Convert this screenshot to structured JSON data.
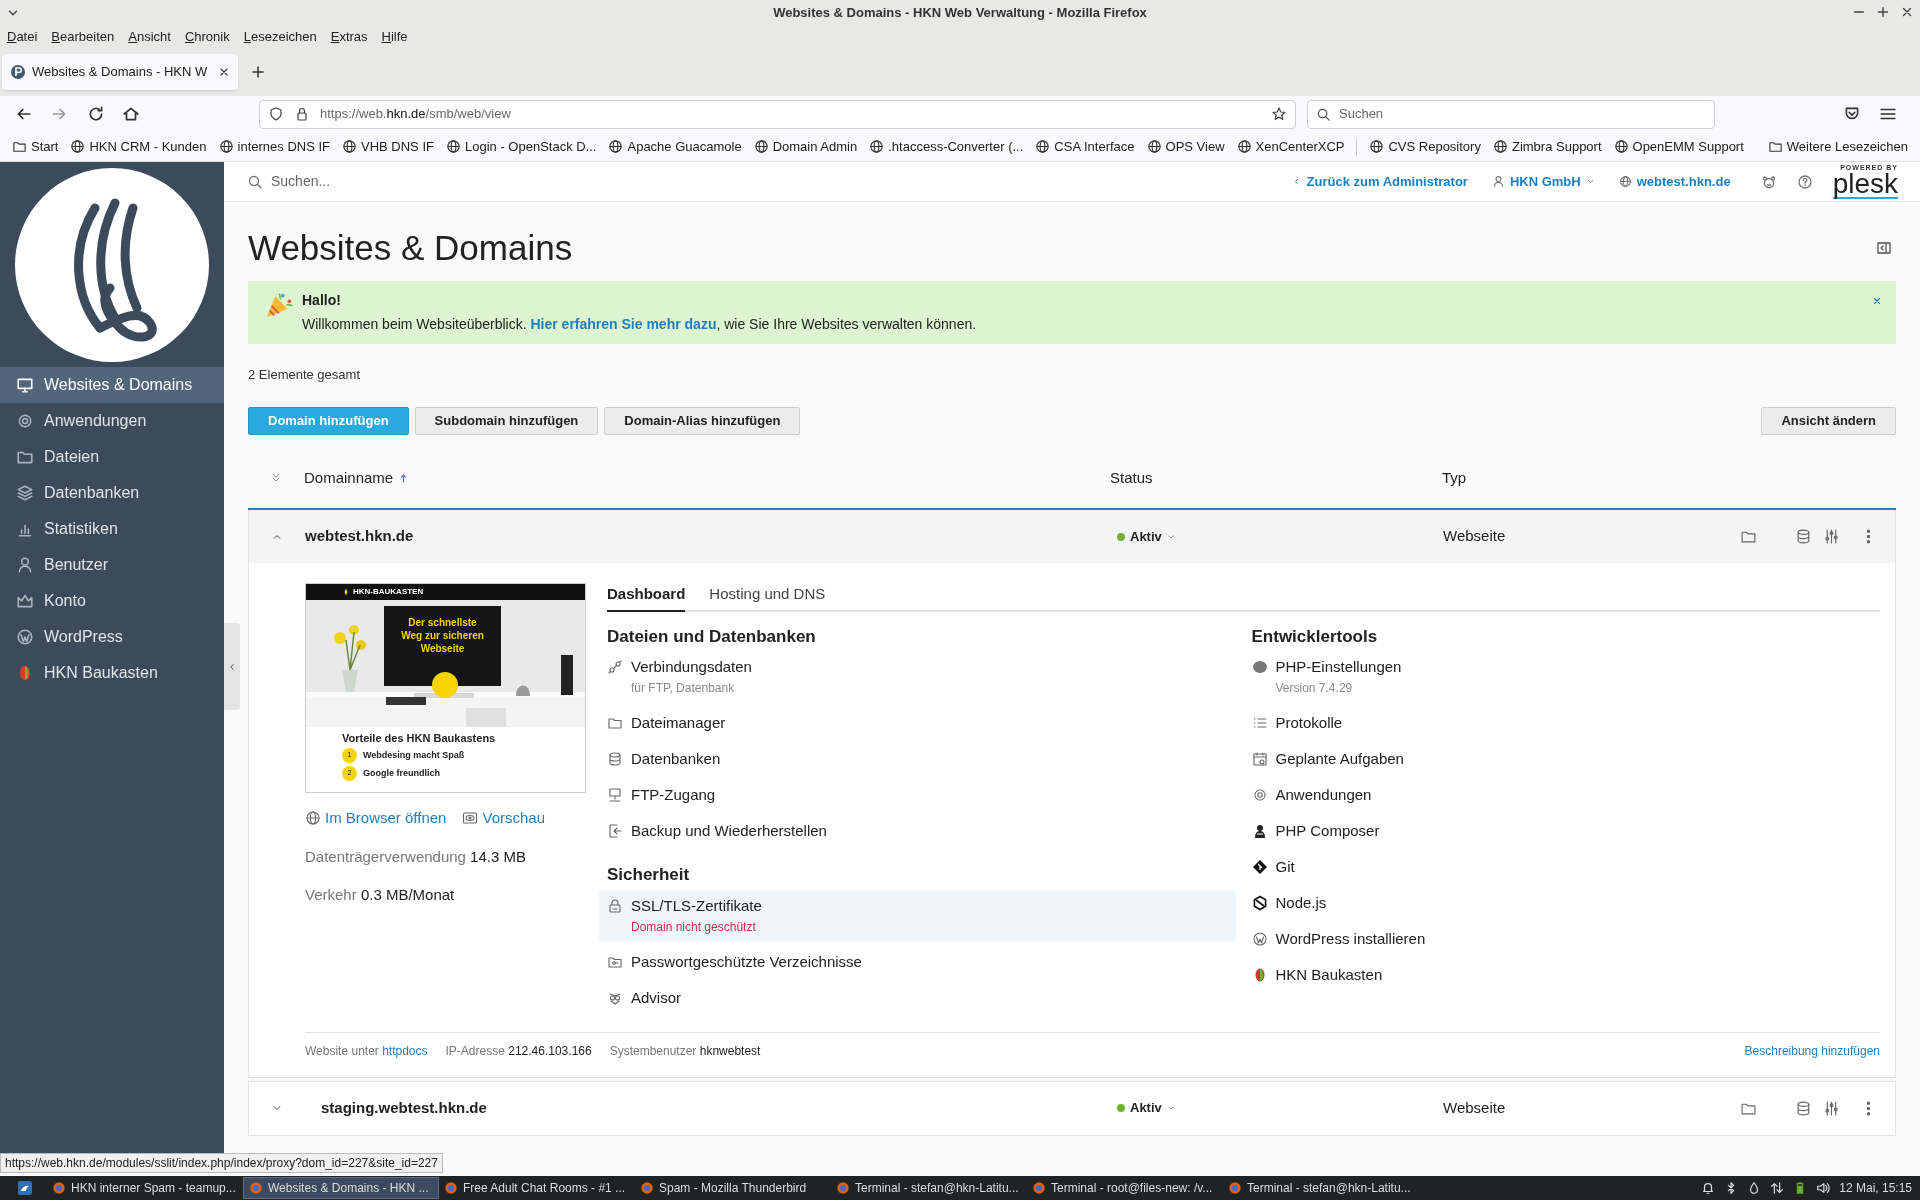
{
  "window": {
    "title": "Websites & Domains - HKN Web Verwaltung - Mozilla Firefox"
  },
  "menu_bar": [
    "Datei",
    "Bearbeiten",
    "Ansicht",
    "Chronik",
    "Lesezeichen",
    "Extras",
    "Hilfe"
  ],
  "tabs": [
    {
      "label": "Websites & Domains - HKN W",
      "selected": true
    }
  ],
  "address_bar": {
    "url": "https://web.**hkn.de**/smb/web/view"
  },
  "browser_search": {
    "placeholder": "Suchen"
  },
  "bookmarks": [
    {
      "label": "Start",
      "kind": "folder"
    },
    {
      "label": "HKN CRM - Kunden",
      "kind": "site"
    },
    {
      "label": "internes DNS IF",
      "kind": "site"
    },
    {
      "label": "VHB DNS IF",
      "kind": "site"
    },
    {
      "label": "Login - OpenStack D...",
      "kind": "site"
    },
    {
      "label": "Apache Guacamole",
      "kind": "site"
    },
    {
      "label": "Domain Admin",
      "kind": "site"
    },
    {
      "label": ".htaccess-Converter (...",
      "kind": "site"
    },
    {
      "label": "CSA Interface",
      "kind": "site"
    },
    {
      "label": "OPS View",
      "kind": "site"
    },
    {
      "label": "XenCenterXCP",
      "kind": "site"
    },
    {
      "label": "CVS Repository",
      "kind": "site"
    },
    {
      "label": "Zimbra Support",
      "kind": "site"
    },
    {
      "label": "OpenEMM Support",
      "kind": "site"
    }
  ],
  "other_bookmarks": "Weitere Lesezeichen",
  "sidebar": {
    "items": [
      {
        "label": "Websites & Domains",
        "selected": true
      },
      {
        "label": "Anwendungen",
        "selected": false
      },
      {
        "label": "Dateien",
        "selected": false
      },
      {
        "label": "Datenbanken",
        "selected": false
      },
      {
        "label": "Statistiken",
        "selected": false
      },
      {
        "label": "Benutzer",
        "selected": false
      },
      {
        "label": "Konto",
        "selected": false
      },
      {
        "label": "WordPress",
        "selected": false
      },
      {
        "label": "HKN Baukasten",
        "selected": false
      }
    ]
  },
  "header": {
    "search_placeholder": "Suchen...",
    "back_link": "Zurück zum Administrator",
    "account": "HKN GmbH",
    "domain": "webtest.hkn.de",
    "powered_by": "POWERED BY",
    "brand": "plesk"
  },
  "page_title": "Websites & Domains",
  "banner": {
    "title": "Hallo!",
    "message": "Willkommen beim Websiteüberblick. ",
    "link": "Hier erfahren Sie mehr dazu",
    "message_end": ", wie Sie Ihre Websites verwalten können."
  },
  "item_count": "2 Elemente gesamt",
  "toolbar": {
    "buttons": [
      {
        "label": "Domain hinzufügen",
        "primary": true
      },
      {
        "label": "Subdomain hinzufügen",
        "primary": false
      },
      {
        "label": "Domain-Alias hinzufügen",
        "primary": false
      }
    ],
    "view_button": "Ansicht ändern"
  },
  "table": {
    "columns": [
      "Domainname",
      "Status",
      "Typ"
    ],
    "rows": [
      {
        "domain": "webtest.hkn.de",
        "status": {
          "label": "Aktiv",
          "color": "#6bb42c"
        },
        "type": "Webseite",
        "expanded": true
      },
      {
        "domain": "staging.webtest.hkn.de",
        "status": {
          "label": "Aktiv",
          "color": "#6bb42c"
        },
        "type": "Webseite",
        "expanded": false
      }
    ]
  },
  "detail": {
    "preview": {
      "logo": "HKN-BAUKASTEN",
      "headline": "Der schnellste Weg zur sicheren Webseite",
      "section": "Vorteile des HKN Baukastens",
      "points": [
        {
          "number": "1",
          "title": "Webdesing macht Spaß"
        },
        {
          "number": "2",
          "title": "Google freundlich"
        }
      ]
    },
    "links": [
      "Im Browser öffnen",
      "Vorschau"
    ],
    "stats": [
      {
        "label": "Datenträgerverwendung",
        "value": "14.3 MB"
      },
      {
        "label": "Verkehr",
        "value": "0.3 MB/Monat"
      }
    ],
    "tabs": [
      {
        "label": "Dashboard",
        "selected": true
      },
      {
        "label": "Hosting und DNS",
        "selected": false
      }
    ],
    "columns": [
      [
        {
          "title": "Dateien und Datenbanken",
          "items": [
            {
              "label": "Verbindungsdaten",
              "sub": "für FTP, Datenbank",
              "highlighted": false,
              "warning": false
            },
            {
              "label": "Dateimanager",
              "highlighted": false
            },
            {
              "label": "Datenbanken",
              "highlighted": false
            },
            {
              "label": "FTP-Zugang",
              "highlighted": false
            },
            {
              "label": "Backup und Wiederherstellen",
              "highlighted": false
            }
          ]
        },
        {
          "title": "Sicherheit",
          "items": [
            {
              "label": "SSL/TLS-Zertifikate",
              "sub": "Domain nicht geschützt",
              "highlighted": true,
              "warning": true
            },
            {
              "label": "Passwortgeschützte Verzeichnisse",
              "highlighted": false
            },
            {
              "label": "Advisor",
              "highlighted": false
            }
          ]
        }
      ],
      [
        {
          "title": "Entwicklertools",
          "items": [
            {
              "label": "PHP-Einstellungen",
              "sub": "Version 7.4.29",
              "highlighted": false,
              "warning": false
            },
            {
              "label": "Protokolle",
              "highlighted": false
            },
            {
              "label": "Geplante Aufgaben",
              "highlighted": false
            },
            {
              "label": "Anwendungen",
              "highlighted": false
            },
            {
              "label": "PHP Composer",
              "highlighted": false
            },
            {
              "label": "Git",
              "highlighted": false
            },
            {
              "label": "Node.js",
              "highlighted": false
            },
            {
              "label": "WordPress installieren",
              "highlighted": false
            },
            {
              "label": "HKN Baukasten",
              "highlighted": false
            }
          ]
        }
      ]
    ],
    "footer": [
      {
        "label": "Website unter",
        "value": "httpdocs",
        "link": true
      },
      {
        "label": "IP-Adresse",
        "value": "212.46.103.166",
        "link": false
      },
      {
        "label": "Systembenutzer",
        "value": "hknwebtest",
        "link": false
      }
    ],
    "footer_link": "Beschreibung hinzufügen"
  },
  "status_url": "https://web.hkn.de/modules/sslit/index.php/index/proxy?dom_id=227&site_id=227",
  "taskbar": {
    "tasks": [
      {
        "label": "HKN interner Spam - teamup...",
        "selected": false
      },
      {
        "label": "Websites & Domains - HKN ...",
        "selected": true
      },
      {
        "label": "Free Adult Chat Rooms - #1 ...",
        "selected": false
      },
      {
        "label": "Spam - Mozilla Thunderbird",
        "selected": false
      },
      {
        "label": "Terminal - stefan@hkn-Latitu...",
        "selected": false
      },
      {
        "label": "Terminal - root@files-new: /v...",
        "selected": false
      },
      {
        "label": "Terminal - stefan@hkn-Latitu...",
        "selected": false
      }
    ],
    "clock": "12 Mai, 15:15"
  }
}
